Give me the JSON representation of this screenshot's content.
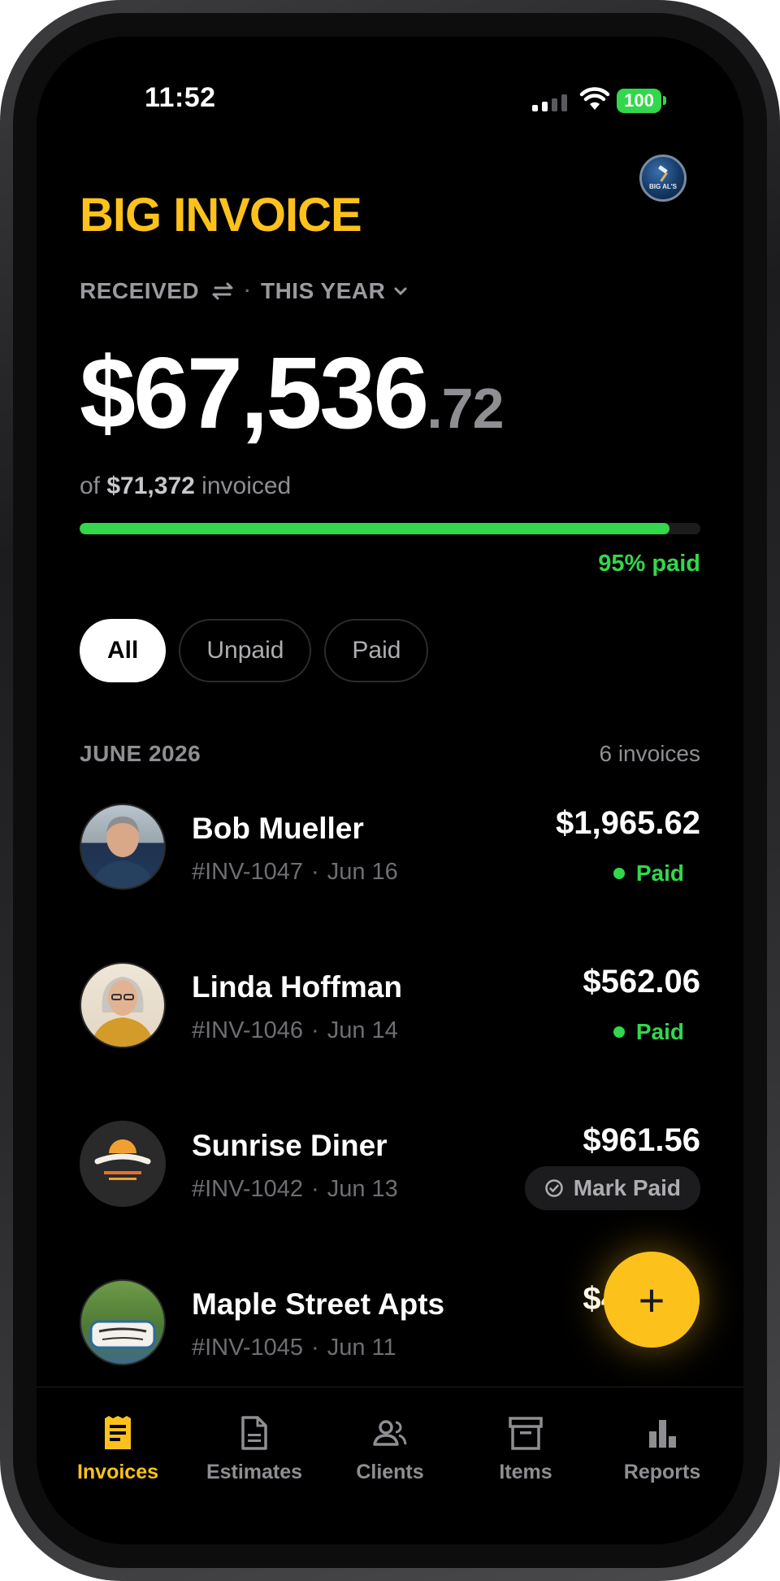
{
  "status_bar": {
    "time": "11:52",
    "battery": "100"
  },
  "header": {
    "app_title": "BIG INVOICE",
    "logo_text": "BIG AL'S"
  },
  "summary": {
    "mode": "RECEIVED",
    "period": "THIS YEAR",
    "amount_main": "$67,536",
    "amount_cents": ".72",
    "of_prefix": "of",
    "invoiced_total": "$71,372",
    "of_suffix": "invoiced",
    "paid_fraction": 0.95,
    "paid_label": "95% paid"
  },
  "chips": [
    {
      "label": "All",
      "active": true
    },
    {
      "label": "Unpaid",
      "active": false
    },
    {
      "label": "Paid",
      "active": false
    }
  ],
  "section": {
    "label": "JUNE 2026",
    "count": "6 invoices"
  },
  "invoices": [
    {
      "name": "Bob Mueller",
      "number": "#INV-1047",
      "date": "Jun 16",
      "amount": "$1,965.62",
      "status": "Paid"
    },
    {
      "name": "Linda Hoffman",
      "number": "#INV-1046",
      "date": "Jun 14",
      "amount": "$562.06",
      "status": "Paid"
    },
    {
      "name": "Sunrise Diner",
      "number": "#INV-1042",
      "date": "Jun 13",
      "amount": "$961.56",
      "action": "Mark Paid"
    },
    {
      "name": "Maple Street Apts",
      "number": "#INV-1045",
      "date": "Jun 11",
      "amount": "$449.95"
    }
  ],
  "fab": {
    "label": "+"
  },
  "tabs": [
    {
      "label": "Invoices",
      "icon": "receipt-icon",
      "active": true
    },
    {
      "label": "Estimates",
      "icon": "document-icon",
      "active": false
    },
    {
      "label": "Clients",
      "icon": "people-icon",
      "active": false
    },
    {
      "label": "Items",
      "icon": "box-icon",
      "active": false
    },
    {
      "label": "Reports",
      "icon": "bar-chart-icon",
      "active": false
    }
  ],
  "colors": {
    "accent": "#fcc21b",
    "paid": "#32d74b",
    "background": "#000000"
  }
}
